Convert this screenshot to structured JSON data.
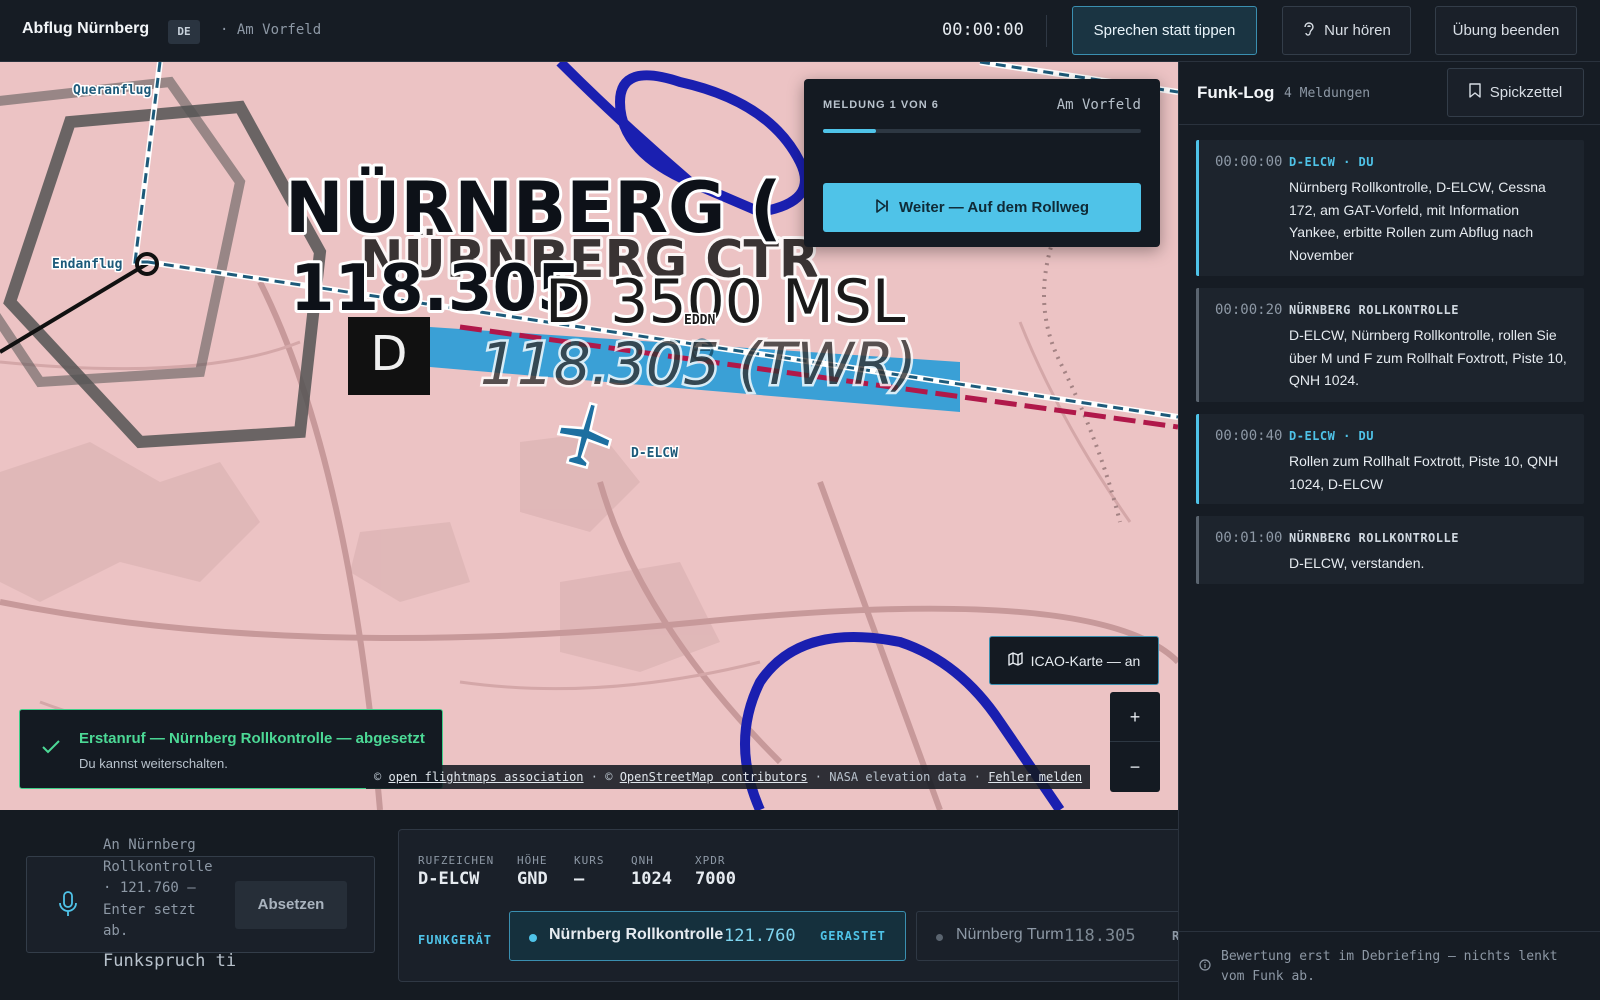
{
  "header": {
    "title": "Abflug Nürnberg",
    "lang": "DE",
    "phase": "· Am Vorfeld",
    "timer": "00:00:00",
    "btn_speak": "Sprechen statt tippen",
    "btn_listen": "Nur hören",
    "btn_end": "Übung beenden"
  },
  "map": {
    "labels": {
      "crosswind": "Queranflug",
      "final": "Endanflug",
      "ctr_name": "NÜRNBERG (",
      "ctr_name_shadow": "NÜRNBERG CTR",
      "freq_big": "118.305",
      "class_d": "D",
      "altitude": "D   3500 MSL",
      "airport": "EDDN",
      "twr_freq": "118.305 (TWR)",
      "class_d_box": "D",
      "callsign": "D-ELCW"
    },
    "message_card": {
      "counter": "MELDUNG 1 VON 6",
      "phase": "Am Vorfeld",
      "progress": 0.1667,
      "next_button": "Weiter — Auf dem Rollweg"
    },
    "icao_button": "ICAO-Karte — an",
    "zoom_in": "+",
    "zoom_out": "−",
    "toast": {
      "title": "Erstanruf — Nürnberg Rollkontrolle — abgesetzt",
      "subtitle": "Du kannst weiterschalten."
    },
    "attribution": {
      "c1": "©",
      "link1": "open flightmaps association",
      "sep1": "· ©",
      "link2": "OpenStreetMap contributors",
      "text3": "· NASA elevation data ·",
      "link3": "Fehler melden"
    }
  },
  "input": {
    "placeholder": "An Nürnberg Rollkontrolle · 121.760 — Enter setzt ab.",
    "value": "Funkspruch ti",
    "send_button": "Absetzen"
  },
  "status": {
    "callsign_label": "RUFZEICHEN",
    "callsign": "D-ELCW",
    "altitude_label": "HÖHE",
    "altitude": "GND",
    "heading_label": "KURS",
    "heading": "—",
    "qnh_label": "QNH",
    "qnh": "1024",
    "xpdr_label": "XPDR",
    "xpdr": "7000",
    "radio_label": "FUNKGERÄT",
    "radio_active": {
      "name": "Nürnberg Rollkontrolle",
      "freq": "121.760",
      "tag": "GERASTET"
    },
    "radio_other": {
      "name": "Nürnberg Turm",
      "freq": "118.305",
      "tag": "R"
    }
  },
  "log": {
    "title": "Funk-Log",
    "count": "4 Meldungen",
    "cheat_button": "Spickzettel",
    "entries": [
      {
        "time": "00:00:00",
        "speaker": "D-ELCW · DU",
        "text": "Nürnberg Rollkontrolle, D-ELCW, Cessna 172, am GAT-Vorfeld, mit Information Yankee, erbitte Rollen zum Abflug nach November"
      },
      {
        "time": "00:00:20",
        "speaker": "NÜRNBERG ROLLKONTROLLE",
        "text": "D-ELCW, Nürnberg Rollkontrolle, rollen Sie über M und F zum Rollhalt Foxtrott, Piste 10, QNH 1024."
      },
      {
        "time": "00:00:40",
        "speaker": "D-ELCW · DU",
        "text": "Rollen zum Rollhalt Foxtrott, Piste 10, QNH 1024, D-ELCW"
      },
      {
        "time": "00:01:00",
        "speaker": "NÜRNBERG ROLLKONTROLLE",
        "text": "D-ELCW, verstanden."
      }
    ],
    "footer": "Bewertung erst im Debriefing — nichts lenkt vom Funk ab."
  },
  "colors": {
    "accent": "#4fc3e8",
    "success": "#3fd08a",
    "map_bg": "#ecc3c4",
    "taxiway_blue": "#1a1fb0"
  },
  "icons": {
    "listen": "ear-icon",
    "next": "skip-forward-icon",
    "icao": "map-icon",
    "cheat": "bookmark-icon",
    "toast": "check-icon",
    "mic": "microphone-icon",
    "footer": "info-icon",
    "aircraft": "airplane-icon"
  }
}
